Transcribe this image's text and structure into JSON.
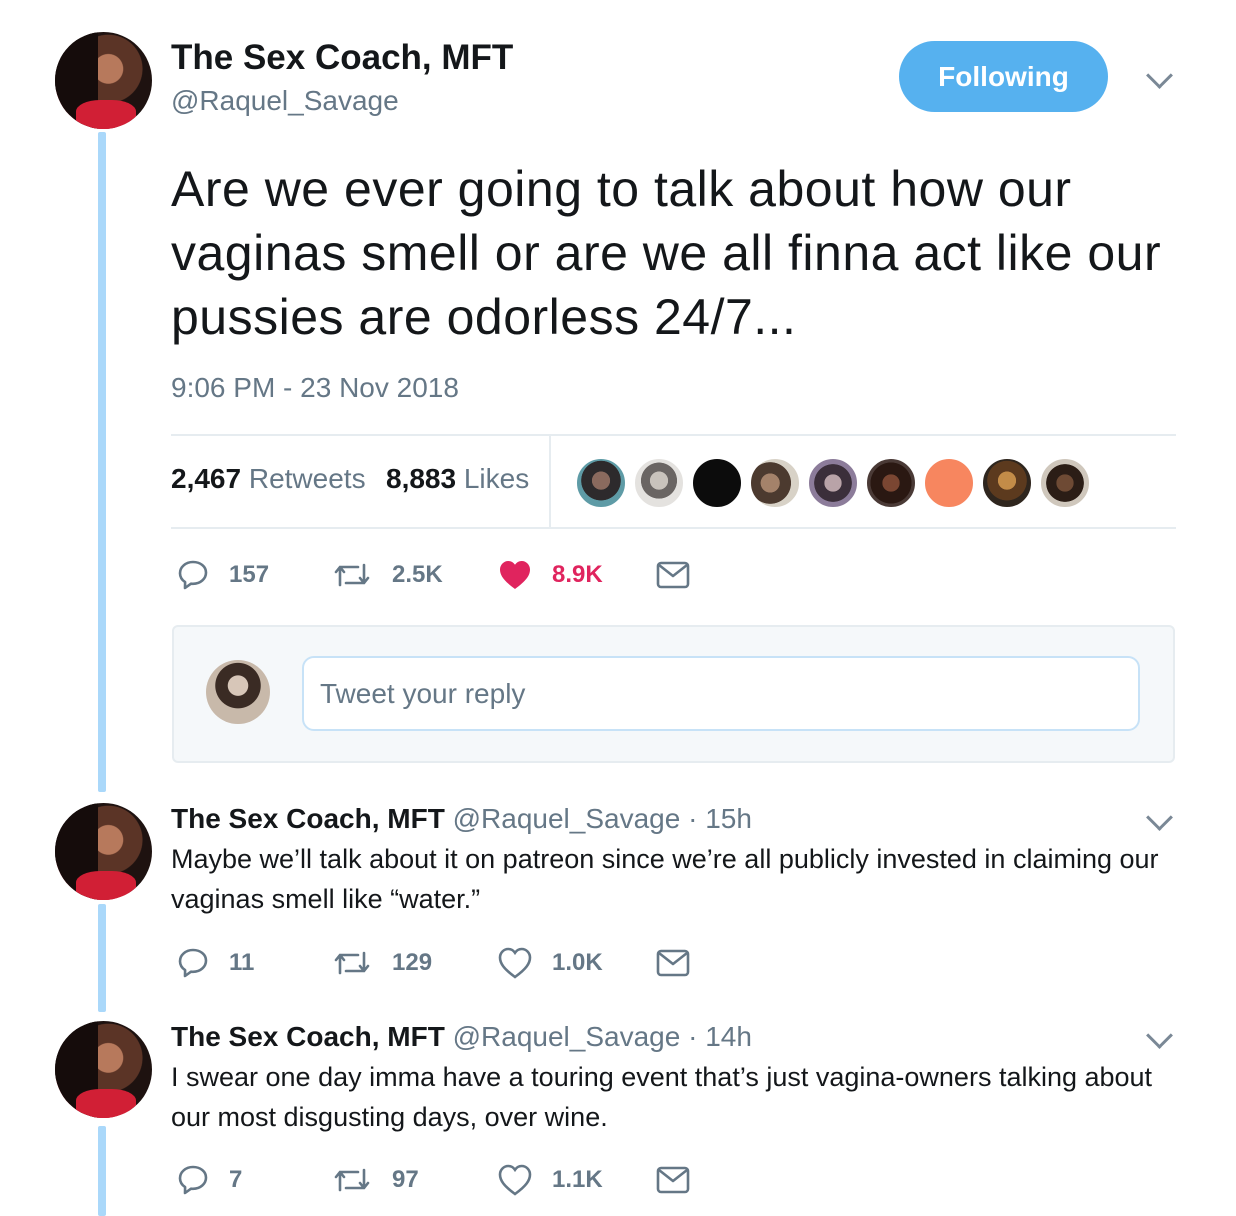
{
  "tweet": {
    "author_name": "The Sex Coach, MFT",
    "author_handle": "@Raquel_Savage",
    "follow_label": "Following",
    "text": "Are we ever going to talk about how our vaginas smell or are we all finna act like our pussies are odorless 24/7...",
    "timestamp": "9:06 PM - 23 Nov 2018",
    "retweets_count": "2,467",
    "retweets_label": "Retweets",
    "likes_count": "8,883",
    "likes_label": "Likes",
    "actions": {
      "replies": "157",
      "retweets": "2.5K",
      "likes": "8.9K"
    },
    "like_color": "#e0245e"
  },
  "reply_composer": {
    "placeholder": "Tweet your reply"
  },
  "replies": [
    {
      "author_name": "The Sex Coach, MFT",
      "author_handle": "@Raquel_Savage",
      "time": "· 15h",
      "text": "Maybe we’ll talk about it on patreon since we’re all publicly invested in claiming our vaginas smell like “water.”",
      "actions": {
        "replies": "11",
        "retweets": "129",
        "likes": "1.0K"
      }
    },
    {
      "author_name": "The Sex Coach, MFT",
      "author_handle": "@Raquel_Savage",
      "time": "· 14h",
      "text": "I swear one day imma have a touring event that’s just vagina-owners talking about our most disgusting days, over wine.",
      "actions": {
        "replies": "7",
        "retweets": "97",
        "likes": "1.1K"
      }
    }
  ],
  "colors": {
    "accent": "#56b1ef",
    "thread_line": "#aad8fa",
    "secondary_text": "#657786"
  }
}
